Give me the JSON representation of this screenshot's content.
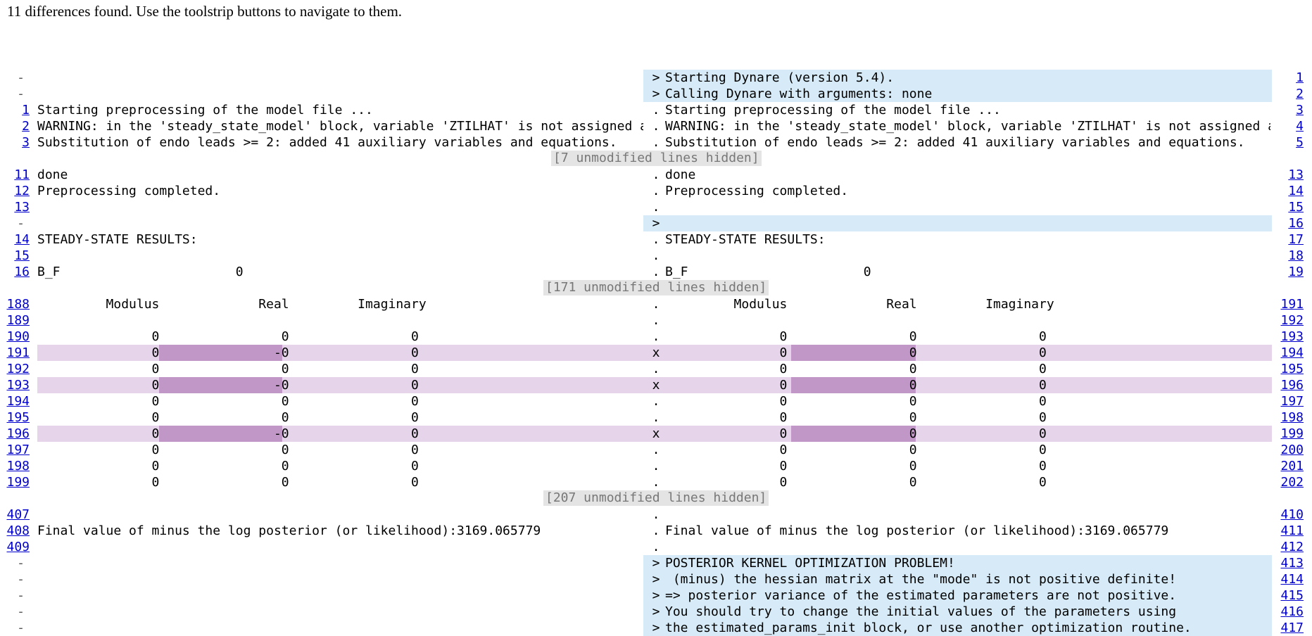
{
  "summary": "11 differences found. Use the toolstrip buttons to navigate to them.",
  "colors": {
    "added_bg": "#d6ebf7",
    "changed_bg": "#e6d5ea",
    "highlight_bg": "#c097c6",
    "link": "#0000cc",
    "hidden_banner_bg": "#e4e4e4"
  },
  "rows": [
    {
      "type": "added",
      "lnum": "-",
      "left": "",
      "mark": ">",
      "right": "Starting Dynare (version 5.4).",
      "rnum": "1"
    },
    {
      "type": "added",
      "lnum": "-",
      "left": "",
      "mark": ">",
      "right": "Calling Dynare with arguments: none",
      "rnum": "2"
    },
    {
      "type": "same",
      "lnum": "1",
      "left": "Starting preprocessing of the model file ...",
      "mark": ".",
      "right": "Starting preprocessing of the model file ...",
      "rnum": "3"
    },
    {
      "type": "same",
      "lnum": "2",
      "left": "WARNING: in the 'steady_state_model' block, variable 'ZTILHAT' is not assigned a value",
      "mark": ".",
      "right": "WARNING: in the 'steady_state_model' block, variable 'ZTILHAT' is not assigned a value",
      "rnum": "4"
    },
    {
      "type": "same",
      "lnum": "3",
      "left": "Substitution of endo leads >= 2: added 41 auxiliary variables and equations.",
      "mark": ".",
      "right": "Substitution of endo leads >= 2: added 41 auxiliary variables and equations.",
      "rnum": "5"
    },
    {
      "type": "hidden",
      "text": "[7 unmodified lines hidden]"
    },
    {
      "type": "same",
      "lnum": "11",
      "left": "done",
      "mark": ".",
      "right": "done",
      "rnum": "13"
    },
    {
      "type": "same",
      "lnum": "12",
      "left": "Preprocessing completed.",
      "mark": ".",
      "right": "Preprocessing completed.",
      "rnum": "14"
    },
    {
      "type": "same",
      "lnum": "13",
      "left": "",
      "mark": ".",
      "right": "",
      "rnum": "15"
    },
    {
      "type": "added",
      "lnum": "-",
      "left": "",
      "mark": ">",
      "right": "",
      "rnum": "16"
    },
    {
      "type": "same",
      "lnum": "14",
      "left": "STEADY-STATE RESULTS:",
      "mark": ".",
      "right": "STEADY-STATE RESULTS:",
      "rnum": "17"
    },
    {
      "type": "same",
      "lnum": "15",
      "left": "",
      "mark": ".",
      "right": "",
      "rnum": "18"
    },
    {
      "type": "same",
      "lnum": "16",
      "left": "B_F                       0",
      "mark": ".",
      "right": "B_F                       0",
      "rnum": "19"
    },
    {
      "type": "hidden",
      "text": "[171 unmodified lines hidden]"
    },
    {
      "type": "same",
      "lnum": "188",
      "left": "         Modulus             Real         Imaginary",
      "mark": ".",
      "right": "         Modulus             Real         Imaginary",
      "rnum": "191"
    },
    {
      "type": "same",
      "lnum": "189",
      "left": "",
      "mark": ".",
      "right": "",
      "rnum": "192"
    },
    {
      "type": "same",
      "lnum": "190",
      "left": "               0                0                0",
      "mark": ".",
      "right": "               0                0                0",
      "rnum": "193"
    },
    {
      "type": "changed",
      "lnum": "191",
      "left": "               0               -0                0",
      "mark": "x",
      "right": "               0                0                0",
      "rnum": "194"
    },
    {
      "type": "same",
      "lnum": "192",
      "left": "               0                0                0",
      "mark": ".",
      "right": "               0                0                0",
      "rnum": "195"
    },
    {
      "type": "changed",
      "lnum": "193",
      "left": "               0               -0                0",
      "mark": "x",
      "right": "               0                0                0",
      "rnum": "196"
    },
    {
      "type": "same",
      "lnum": "194",
      "left": "               0                0                0",
      "mark": ".",
      "right": "               0                0                0",
      "rnum": "197"
    },
    {
      "type": "same",
      "lnum": "195",
      "left": "               0                0                0",
      "mark": ".",
      "right": "               0                0                0",
      "rnum": "198"
    },
    {
      "type": "changed",
      "lnum": "196",
      "left": "               0               -0                0",
      "mark": "x",
      "right": "               0                0                0",
      "rnum": "199"
    },
    {
      "type": "same",
      "lnum": "197",
      "left": "               0                0                0",
      "mark": ".",
      "right": "               0                0                0",
      "rnum": "200"
    },
    {
      "type": "same",
      "lnum": "198",
      "left": "               0                0                0",
      "mark": ".",
      "right": "               0                0                0",
      "rnum": "201"
    },
    {
      "type": "same",
      "lnum": "199",
      "left": "               0                0                0",
      "mark": ".",
      "right": "               0                0                0",
      "rnum": "202"
    },
    {
      "type": "hidden",
      "text": "[207 unmodified lines hidden]"
    },
    {
      "type": "same",
      "lnum": "407",
      "left": "",
      "mark": ".",
      "right": "",
      "rnum": "410"
    },
    {
      "type": "same",
      "lnum": "408",
      "left": "Final value of minus the log posterior (or likelihood):3169.065779",
      "mark": ".",
      "right": "Final value of minus the log posterior (or likelihood):3169.065779",
      "rnum": "411"
    },
    {
      "type": "same",
      "lnum": "409",
      "left": "",
      "mark": ".",
      "right": "",
      "rnum": "412"
    },
    {
      "type": "added",
      "lnum": "-",
      "left": "",
      "mark": ">",
      "right": "POSTERIOR KERNEL OPTIMIZATION PROBLEM!",
      "rnum": "413"
    },
    {
      "type": "added",
      "lnum": "-",
      "left": "",
      "mark": ">",
      "right": " (minus) the hessian matrix at the \"mode\" is not positive definite!",
      "rnum": "414"
    },
    {
      "type": "added",
      "lnum": "-",
      "left": "",
      "mark": ">",
      "right": "=> posterior variance of the estimated parameters are not positive.",
      "rnum": "415"
    },
    {
      "type": "added",
      "lnum": "-",
      "left": "",
      "mark": ">",
      "right": "You should try to change the initial values of the parameters using",
      "rnum": "416"
    },
    {
      "type": "added",
      "lnum": "-",
      "left": "",
      "mark": ">",
      "right": "the estimated_params_init block, or use another optimization routine.",
      "rnum": "417"
    }
  ]
}
